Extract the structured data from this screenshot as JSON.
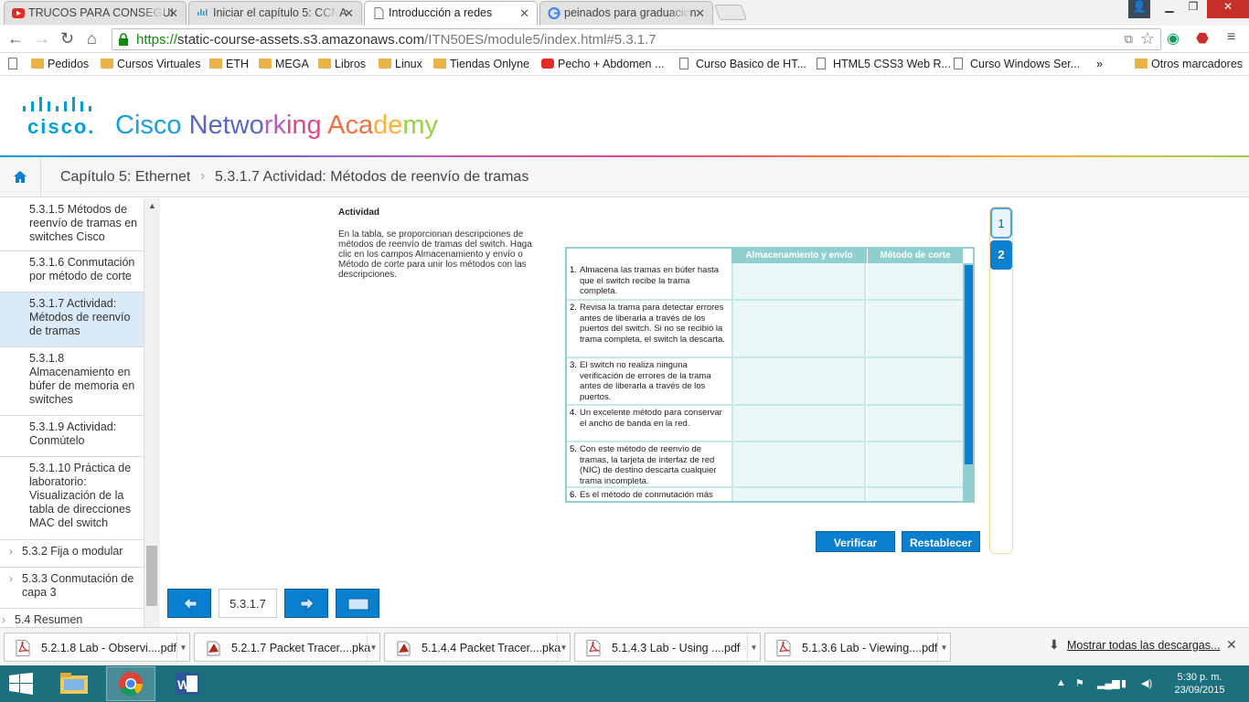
{
  "browser": {
    "tabs": [
      {
        "title": "TRUCOS PARA CONSEGUI",
        "icon": "youtube-icon",
        "active": false
      },
      {
        "title": "Iniciar el capítulo 5: CCNA",
        "icon": "cisco-icon",
        "active": false
      },
      {
        "title": "Introducción a redes",
        "icon": "page-icon",
        "active": true
      },
      {
        "title": "peinados para graduacion",
        "icon": "google-icon",
        "active": false
      }
    ],
    "url": {
      "scheme": "https://",
      "host": "static-course-assets.s3.amazonaws.com",
      "path": "/ITN50ES/module5/index.html#5.3.1.7"
    },
    "bookmarks": [
      {
        "label": "Pedidos",
        "icon": "folder"
      },
      {
        "label": "Cursos Virtuales",
        "icon": "folder"
      },
      {
        "label": "ETH",
        "icon": "folder"
      },
      {
        "label": "MEGA",
        "icon": "folder"
      },
      {
        "label": "Libros",
        "icon": "folder"
      },
      {
        "label": "Linux",
        "icon": "folder"
      },
      {
        "label": "Tiendas Onlyne",
        "icon": "folder"
      },
      {
        "label": "Pecho + Abdomen ...",
        "icon": "youtube"
      },
      {
        "label": "Curso Basico de HT...",
        "icon": "page"
      },
      {
        "label": "HTML5 CSS3 Web R...",
        "icon": "page"
      },
      {
        "label": "Curso Windows Ser...",
        "icon": "page"
      }
    ],
    "bookmarks_more": "»",
    "other_bookmarks": "Otros marcadores"
  },
  "header": {
    "logo_text": "cisco.",
    "academy_words": [
      {
        "text": "Cisco ",
        "color": "#1a9fd8"
      },
      {
        "text": "Netwo",
        "color": "#5b67c5"
      },
      {
        "text": "rk",
        "color": "#b85cc0"
      },
      {
        "text": "ing ",
        "color": "#e0488a"
      },
      {
        "text": "Aca",
        "color": "#f37040"
      },
      {
        "text": "de",
        "color": "#f9b13a"
      },
      {
        "text": "my",
        "color": "#9bcf47"
      }
    ]
  },
  "breadcrumb": {
    "chapter": "Capítulo 5: Ethernet",
    "separator": "›",
    "page": "5.3.1.7 Actividad: Métodos de reenvío de tramas"
  },
  "sidebar": {
    "items": [
      {
        "label": "5.3.1.5 Métodos de reenvío de tramas en switches Cisco",
        "active": false,
        "section": false
      },
      {
        "label": "5.3.1.6 Conmutación por método de corte",
        "active": false,
        "section": false
      },
      {
        "label": "5.3.1.7 Actividad: Métodos de reenvío de tramas",
        "active": true,
        "section": false
      },
      {
        "label": "5.3.1.8 Almacenamiento en búfer de memoria en switches",
        "active": false,
        "section": false
      },
      {
        "label": "5.3.1.9 Actividad: Conmútelo",
        "active": false,
        "section": false
      },
      {
        "label": "5.3.1.10 Práctica de laboratorio: Visualización de la tabla de direcciones MAC del switch",
        "active": false,
        "section": false
      },
      {
        "label": "5.3.2 Fija o modular",
        "active": false,
        "section": true
      },
      {
        "label": "5.3.3 Conmutación de capa 3",
        "active": false,
        "section": true
      },
      {
        "label": "5.4 Resumen",
        "active": false,
        "section": true
      }
    ]
  },
  "activity": {
    "title": "Actividad",
    "description": "En la tabla, se proporcionan descripciones de métodos de reenvío de tramas del switch. Haga clic en los campos Almacenamiento y envío o Método de corte para unir los métodos con las descripciones.",
    "columns": [
      "Almacenamiento y envío",
      "Método de corte"
    ],
    "rows": [
      {
        "num": "1.",
        "text": "Almacena las tramas en búfer hasta que el switch recibe la trama completa."
      },
      {
        "num": "2.",
        "text": "Revisa la trama para detectar errores antes de liberarla a través de los puertos del switch. Si no se recibió la trama completa, el switch la descarta."
      },
      {
        "num": "3.",
        "text": "El switch no realiza ninguna verificación de errores de la trama antes de liberarla a través de los puertos."
      },
      {
        "num": "4.",
        "text": "Un excelente método para conservar el ancho de banda en la red."
      },
      {
        "num": "5.",
        "text": "Con este método de reenvío de tramas, la tarjeta de interfaz de red (NIC) de destino descarta cualquier trama incompleta."
      },
      {
        "num": "6.",
        "text": "Es el método de conmutación más rápido, por lo que produce más"
      }
    ],
    "pages": [
      "1",
      "2"
    ],
    "verify_label": "Verificar",
    "reset_label": "Restablecer"
  },
  "navigation": {
    "page_number": "5.3.1.7"
  },
  "downloads": {
    "items": [
      {
        "name": "5.2.1.8 Lab - Observi....pdf",
        "icon": "pdf-icon"
      },
      {
        "name": "5.2.1.7 Packet Tracer....pka",
        "icon": "packet-tracer-icon"
      },
      {
        "name": "5.1.4.4 Packet Tracer....pka",
        "icon": "packet-tracer-icon"
      },
      {
        "name": "5.1.4.3 Lab - Using ....pdf",
        "icon": "pdf-icon"
      },
      {
        "name": "5.1.3.6 Lab - Viewing....pdf",
        "icon": "pdf-icon"
      }
    ],
    "show_all": "Mostrar todas las descargas...",
    "close": "✕"
  },
  "taskbar": {
    "time": "5:30 p. m.",
    "date": "23/09/2015"
  }
}
